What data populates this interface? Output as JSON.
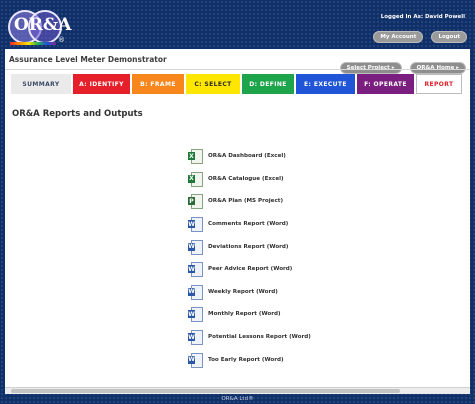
{
  "header": {
    "logo_text": "OR&A",
    "logo_reg": "®",
    "logged_in_text": "Logged In As: David Powell",
    "my_account_label": "My Account",
    "logout_label": "Logout"
  },
  "app": {
    "title": "Assurance Level Meter Demonstrator",
    "select_project_label": "Select Project ▸",
    "home_label": "OR&A Home ▸"
  },
  "tabs": [
    {
      "label": "SUMMARY",
      "color": "#eaeaea"
    },
    {
      "label": "A: IDENTIFY",
      "color": "#e5202b"
    },
    {
      "label": "B: FRAME",
      "color": "#f7861d"
    },
    {
      "label": "C: SELECT",
      "color": "#ffe600"
    },
    {
      "label": "D: DEFINE",
      "color": "#1ea44a"
    },
    {
      "label": "E: EXECUTE",
      "color": "#1f55d6"
    },
    {
      "label": "F: OPERATE",
      "color": "#7a1f7f"
    },
    {
      "label": "REPORT",
      "color": "#ffffff"
    }
  ],
  "section_title": "OR&A Reports and Outputs",
  "reports": [
    {
      "label": "OR&A Dashboard  (Excel)",
      "icon": "excel-icon"
    },
    {
      "label": "OR&A Catalogue  (Excel)",
      "icon": "excel-icon"
    },
    {
      "label": "OR&A Plan  (MS Project)",
      "icon": "ms-project-icon"
    },
    {
      "label": "Comments Report  (Word)",
      "icon": "word-icon"
    },
    {
      "label": "Deviations Report  (Word)",
      "icon": "word-icon"
    },
    {
      "label": "Peer Advice Report  (Word)",
      "icon": "word-icon"
    },
    {
      "label": "Weekly Report  (Word)",
      "icon": "word-icon"
    },
    {
      "label": "Monthly Report  (Word)",
      "icon": "word-icon"
    },
    {
      "label": "Potential Lessons Report  (Word)",
      "icon": "word-icon"
    },
    {
      "label": "Too Early Report  (Word)",
      "icon": "word-icon"
    }
  ],
  "footer": "OR&A Ltd®"
}
